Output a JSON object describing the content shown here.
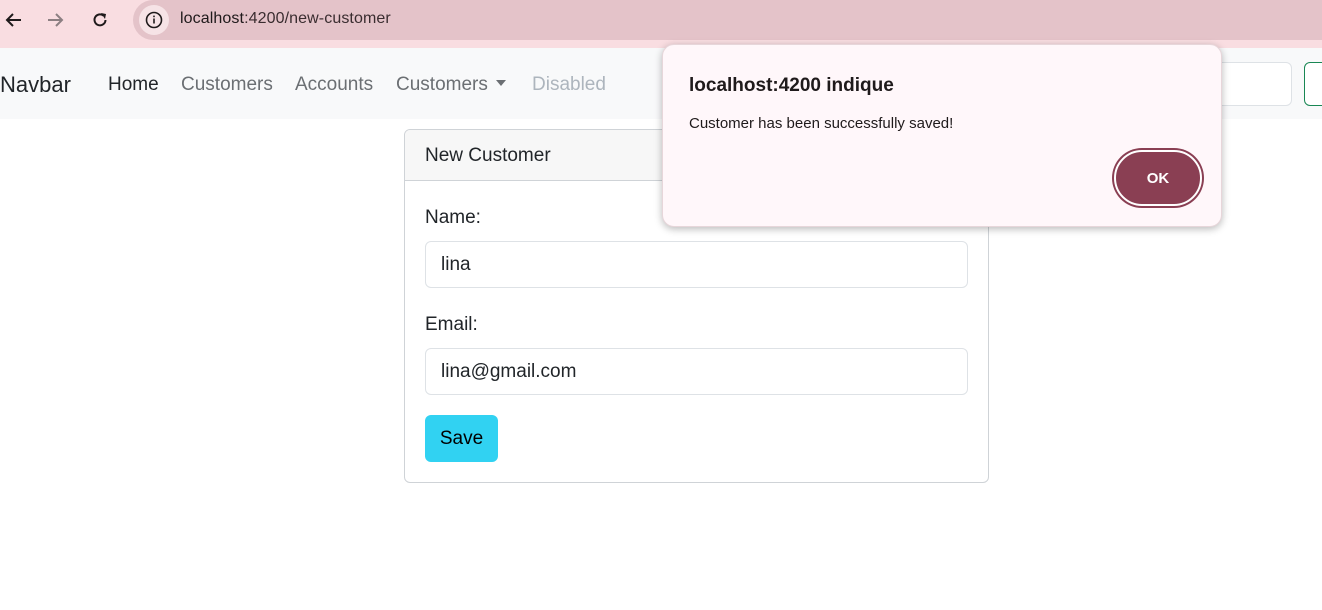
{
  "browser": {
    "url_host": "localhost",
    "url_path": ":4200/new-customer",
    "back_icon": "arrow-left-icon",
    "forward_icon": "arrow-right-icon",
    "reload_icon": "reload-icon",
    "site_info_icon": "info-icon"
  },
  "navbar": {
    "brand": "Navbar",
    "links": [
      {
        "label": "Home"
      },
      {
        "label": "Customers"
      },
      {
        "label": "Accounts"
      },
      {
        "label": "Customers"
      },
      {
        "label": "Disabled"
      }
    ]
  },
  "card": {
    "header": "New Customer",
    "name_label": "Name:",
    "name_value": "lina",
    "email_label": "Email:",
    "email_value": "lina@gmail.com",
    "save_label": "Save"
  },
  "dialog": {
    "title": "localhost:4200 indique",
    "message": "Customer has been successfully saved!",
    "ok_label": "OK"
  },
  "colors": {
    "chrome_bg": "#f9dde1",
    "save_button": "#31d2f2",
    "ok_button": "#8a3f53"
  }
}
